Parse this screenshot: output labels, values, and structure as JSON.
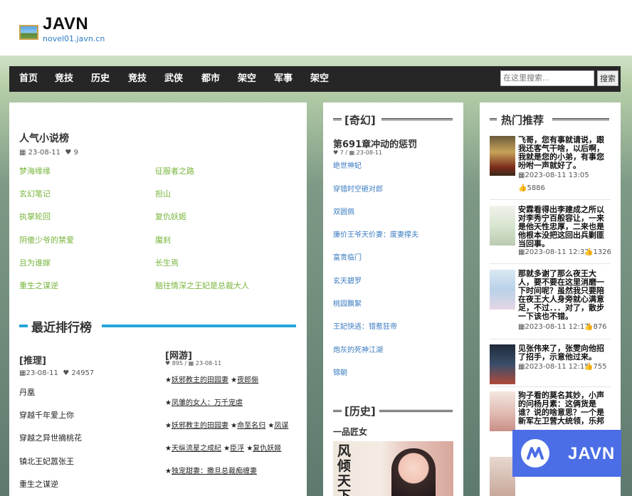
{
  "site": {
    "title": "JAVN",
    "url": "novel01.javn.cn"
  },
  "nav": {
    "items": [
      "首页",
      "竞技",
      "历史",
      "竞技",
      "武侠",
      "都市",
      "架空",
      "军事",
      "架空"
    ],
    "search_placeholder": "在这里搜索...",
    "search_button": "搜索"
  },
  "popular": {
    "title": "人气小说榜",
    "date": "23-08-11",
    "likes": "9",
    "links": [
      [
        "梦海缘缘",
        "征服者之路"
      ],
      [
        "玄幻笔记",
        "担山"
      ],
      [
        "执掌轮回",
        "复仇妖姬"
      ],
      [
        "阴傻少爷的禁爱",
        "魔刹"
      ],
      [
        "且为谁嫁",
        "长生焉"
      ],
      [
        "重生之谋逆",
        "脑往情深之王妃是总裁大人"
      ]
    ]
  },
  "recent": {
    "title": "最近排行榜",
    "left": {
      "category": "[推理]",
      "date": "23-08-11",
      "likes": "24957",
      "items": [
        "丹凰",
        "穿越千年爱上你",
        "穿越之异世摘桃花",
        "镇北王妃嚣张王",
        "重生之谋逆"
      ]
    },
    "right": {
      "category": "[网游]",
      "views": "895",
      "date": "23-08-11",
      "rows": [
        [
          "妖邪教主的田园妻",
          "夜郎俪"
        ],
        [
          "凤雏的女人：万千宠虐"
        ],
        [
          "妖邪教主的田园妻",
          "命至名归",
          "凤谋"
        ],
        [
          "天纵流星之成纪",
          "臣浮",
          "复仇妖姬"
        ],
        [
          "独宠甜妻：撒旦总裁痴缠妻"
        ]
      ]
    }
  },
  "qiji": {
    "title": "[奇幻]",
    "article_title": "第691章冲动的惩罚",
    "likes": "7",
    "date": "23-08-11",
    "links": [
      "绝世神妃",
      "穿错时空砸对郎",
      "双圆佩",
      "廉价王爷天价妻：废妻撑夫",
      "富贵临门",
      "玄天碧罗",
      "桃园飘絮",
      "王妃快逃：错惹狂帝",
      "炮灰的死神江湖",
      "锦朝"
    ]
  },
  "history": {
    "title": "[历史]",
    "book_title": "一品匠女",
    "cover_text": "风倾天下"
  },
  "hot": {
    "title": "热门推荐",
    "items": [
      {
        "title": "飞哥，您有事就请说，跟我还客气干啥，以后啊，我就是您的小弟，有事您吩咐一声就好了。",
        "date": "2023-08-11 13:05",
        "likes": "5886"
      },
      {
        "title": "安霖看得出李建成之所以对李秀宁百般容让，一来是他天性忠厚，二来也是他根本没把这回出兵剿匪当回事。",
        "date": "2023-08-11 12:32",
        "likes": "1326"
      },
      {
        "title": "那就多谢了那么夜王大人，要不要在这里消磨一下时间呢？虽然我只要陪在夜王大人身旁就心满意足，不过．．．对了，散步一下该也不错。",
        "date": "2023-08-11 12:17",
        "likes": "876"
      },
      {
        "title": "见张伟来了，张雯向他招了招手，示意他过来。",
        "date": "2023-08-11 12:15",
        "likes": "755"
      },
      {
        "title": "狗子看的莫名其妙，小声的问杨月素：这俩货是谁？说的啥意思？一个是新军左卫营大统领，乐邦",
        "date": "",
        "likes": ""
      }
    ]
  },
  "badge": {
    "text": "JAVN"
  }
}
